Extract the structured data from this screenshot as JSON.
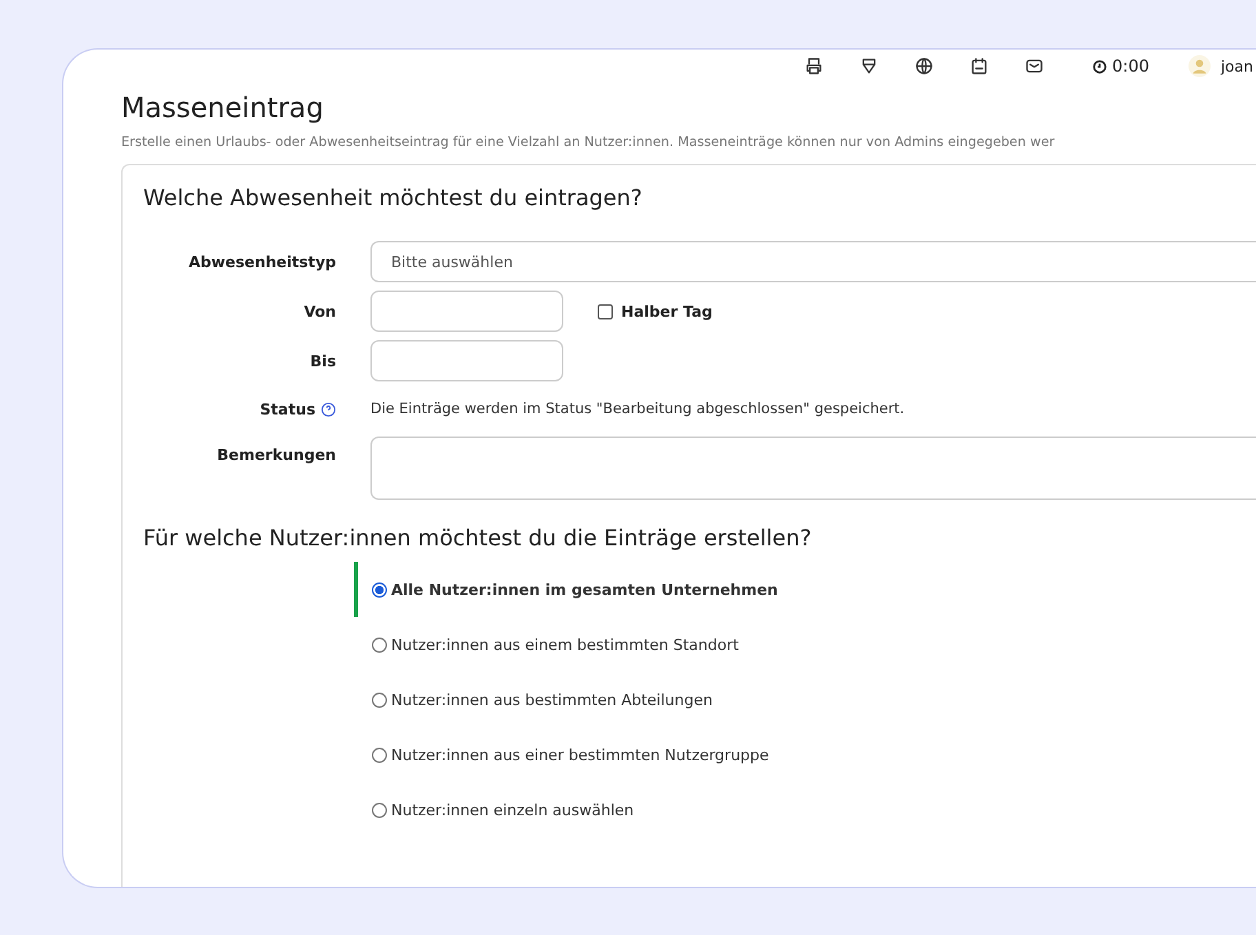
{
  "header": {
    "timer": "0:00",
    "user": "joan"
  },
  "title": "Masseneintrag",
  "description": "Erstelle einen Urlaubs- oder Abwesenheitseintrag für eine Vielzahl an Nutzer:innen. Masseneinträge können nur von Admins eingegeben wer",
  "absence_section": {
    "title": "Welche Abwesenheit möchtest du eintragen?",
    "fields": [
      {
        "kind": "select",
        "label": "Abwesenheitstyp",
        "placeholder": "Bitte auswählen"
      },
      {
        "kind": "date",
        "label": "Von",
        "checkbox": {
          "label": "Halber Tag",
          "checked": false
        }
      },
      {
        "kind": "date",
        "label": "Bis"
      },
      {
        "kind": "info",
        "label": "Status",
        "help": true,
        "text": "Die Einträge werden im Status \"Bearbeitung abgeschlossen\" gespeichert."
      },
      {
        "kind": "textarea",
        "label": "Bemerkungen"
      }
    ]
  },
  "users_section": {
    "title": "Für welche Nutzer:innen möchtest du die Einträge erstellen?",
    "options": [
      {
        "label": "Alle Nutzer:innen im gesamten Unternehmen",
        "selected": true
      },
      {
        "label": "Nutzer:innen aus einem bestimmten Standort",
        "selected": false
      },
      {
        "label": "Nutzer:innen aus bestimmten Abteilungen",
        "selected": false
      },
      {
        "label": "Nutzer:innen aus einer bestimmten Nutzergruppe",
        "selected": false
      },
      {
        "label": "Nutzer:innen einzeln auswählen",
        "selected": false
      }
    ]
  }
}
